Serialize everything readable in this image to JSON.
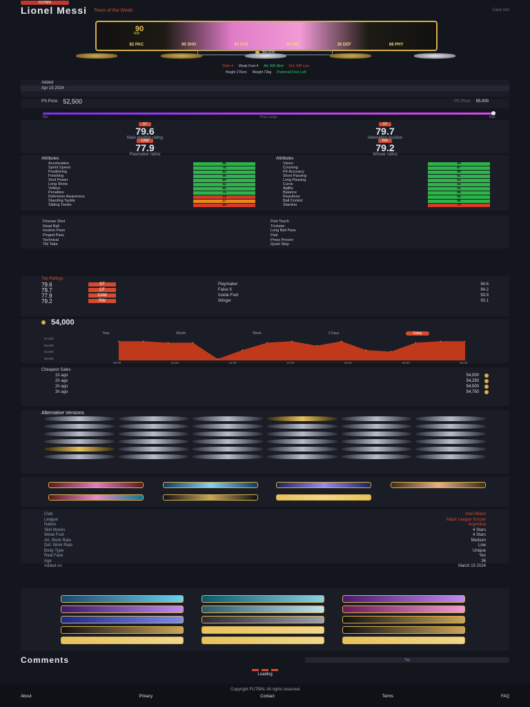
{
  "header": {
    "site_tag": "FUTBIN",
    "title": "Lionel Messi",
    "subtitle": "Team of the Week",
    "right": "Card info"
  },
  "card": {
    "rating": "90",
    "position": "RW",
    "stats": [
      {
        "label": "PAC",
        "value": "82"
      },
      {
        "label": "SHO",
        "value": "90"
      },
      {
        "label": "PAS",
        "value": "94"
      },
      {
        "label": "DRI",
        "value": "95"
      },
      {
        "label": "DEF",
        "value": "38"
      },
      {
        "label": "PHY",
        "value": "68"
      }
    ]
  },
  "price": {
    "value": "54,000",
    "currency_icon": "coin-icon"
  },
  "info": {
    "line1": [
      "Skills 4",
      "Weak Foot 4",
      "Att. WR Med",
      "Def. WR Low"
    ],
    "line2": [
      "Height 170cm",
      "Weight 72kg",
      "Preferred Foot Left"
    ]
  },
  "rows": {
    "meta_label": "Added",
    "meta_value": "Apr 15 2024",
    "sbc_label": "PS Price",
    "sbc_value": "52,500",
    "pc_label": "PC Price",
    "pc_value": "55,000"
  },
  "meter": {
    "label": "Price range",
    "left": "Min",
    "right": "Max"
  },
  "face": [
    {
      "tag": "ST",
      "value": "79.6",
      "cap": "Main position rating"
    },
    {
      "tag": "CF",
      "value": "79.7",
      "cap": "Alternative position"
    },
    {
      "tag": "CAM",
      "value": "77.9",
      "cap": "Playmaker rating"
    },
    {
      "tag": "RW",
      "value": "79.2",
      "cap": "Winger rating"
    }
  ],
  "attr_left": {
    "head": "Attributes",
    "items": [
      {
        "label": "Acceleration",
        "value": "86",
        "cls": ""
      },
      {
        "label": "Sprint Speed",
        "value": "78",
        "cls": ""
      },
      {
        "label": "Positioning",
        "value": "93",
        "cls": ""
      },
      {
        "label": "Finishing",
        "value": "90",
        "cls": ""
      },
      {
        "label": "Shot Power",
        "value": "84",
        "cls": ""
      },
      {
        "label": "Long Shots",
        "value": "92",
        "cls": ""
      },
      {
        "label": "Volleys",
        "value": "85",
        "cls": ""
      },
      {
        "label": "Penalties",
        "value": "75",
        "cls": ""
      },
      {
        "label": "Defensive Awareness",
        "value": "33",
        "cls": "r"
      },
      {
        "label": "Standing Tackle",
        "value": "37",
        "cls": "y"
      },
      {
        "label": "Sliding Tackle",
        "value": "24",
        "cls": "r"
      }
    ]
  },
  "attr_right": {
    "head": "Attributes",
    "items": [
      {
        "label": "Vision",
        "value": "94",
        "cls": ""
      },
      {
        "label": "Crossing",
        "value": "87",
        "cls": ""
      },
      {
        "label": "FK Accuracy",
        "value": "94",
        "cls": ""
      },
      {
        "label": "Short Passing",
        "value": "91",
        "cls": ""
      },
      {
        "label": "Long Passing",
        "value": "91",
        "cls": ""
      },
      {
        "label": "Curve",
        "value": "93",
        "cls": ""
      },
      {
        "label": "Agility",
        "value": "91",
        "cls": ""
      },
      {
        "label": "Balance",
        "value": "95",
        "cls": ""
      },
      {
        "label": "Reactions",
        "value": "92",
        "cls": ""
      },
      {
        "label": "Ball Control",
        "value": "96",
        "cls": ""
      },
      {
        "label": "Stamina",
        "value": "70",
        "cls": "r"
      }
    ]
  },
  "playstyles": {
    "left": [
      "Finesse Shot",
      "Dead Ball",
      "Incisive Pass",
      "Pinged Pass",
      "Technical",
      "Tiki Taka"
    ],
    "right": [
      "First Touch",
      "Trickster",
      "Long Ball Pass",
      "Flair",
      "Press Proven",
      "Quick Step"
    ]
  },
  "ratings": {
    "head": "Top Ratings",
    "rows": [
      {
        "a": "79.6",
        "b": "ST",
        "c": "Playmaker",
        "d": "94.6"
      },
      {
        "a": "79.7",
        "b": "CF",
        "c": "False 9",
        "d": "94.2"
      },
      {
        "a": "77.9",
        "b": "CAM",
        "c": "Inside Fwd",
        "d": "93.9"
      },
      {
        "a": "79.2",
        "b": "RW",
        "c": "Winger",
        "d": "93.1"
      }
    ]
  },
  "chart_data": {
    "type": "area",
    "title": "54,000",
    "tabs": [
      "Year",
      "Month",
      "Week",
      "3 Days",
      "Today"
    ],
    "x": [
      "08:00",
      "10:00",
      "12:00",
      "14:00",
      "16:00",
      "18:00",
      "20:00"
    ],
    "values": [
      56500,
      56500,
      56000,
      56000,
      50500,
      53500,
      56000,
      56500,
      55000,
      56500,
      53500,
      53000,
      56000,
      56500,
      56500
    ],
    "ylim": [
      50000,
      57500
    ],
    "yticks": [
      "57,500",
      "55,000",
      "52,500",
      "50,000"
    ],
    "color": "#c0391b"
  },
  "price_list": {
    "head": "Cheapest Sales",
    "rows": [
      {
        "a": "1h ago",
        "b": "54,000"
      },
      {
        "a": "2h ago",
        "b": "54,250"
      },
      {
        "a": "2h ago",
        "b": "54,500"
      },
      {
        "a": "3h ago",
        "b": "54,750"
      }
    ]
  },
  "alt_head": "Alternative Versions",
  "player_info": {
    "labels": [
      "Club",
      "League",
      "Nation",
      "Skill Moves",
      "Weak Foot",
      "Att. Work Rate",
      "Def. Work Rate",
      "Body Type",
      "Real Face",
      "Age",
      "Added on"
    ],
    "values": [
      "Inter Miami",
      "Major League Soccer",
      "Argentina",
      "4 Stars",
      "4 Stars",
      "Medium",
      "Low",
      "Unique",
      "Yes",
      "36",
      "March 15 2024"
    ]
  },
  "comments": {
    "title": "Comments",
    "sort": "Top",
    "loading": "Loading"
  },
  "footer": {
    "text": "Copyright FUTBIN. All rights reserved.",
    "links": [
      "About",
      "Privacy",
      "Contact",
      "Terms",
      "FAQ"
    ]
  }
}
